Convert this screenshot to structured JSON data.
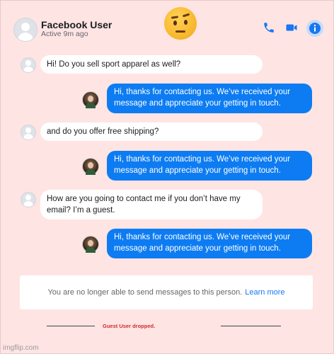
{
  "header": {
    "name": "Facebook User",
    "status": "Active 9m ago",
    "icons": [
      "phone-icon",
      "video-camera-icon",
      "info-icon"
    ]
  },
  "messages": [
    {
      "from": "user",
      "text": "Hi! Do you sell sport apparel as well?"
    },
    {
      "from": "business",
      "text": "Hi, thanks for contacting us. We’ve received your message and appreciate your getting in touch."
    },
    {
      "from": "user",
      "text": "and do you offer free shipping?"
    },
    {
      "from": "business",
      "text": "Hi, thanks for contacting us. We’ve received your message and appreciate your getting in touch."
    },
    {
      "from": "user",
      "text": "How are you going to contact me if you don’t have my email? I’m a guest."
    },
    {
      "from": "business",
      "text": "Hi, thanks for contacting us. We’ve received your message and appreciate your getting in touch."
    }
  ],
  "notice": {
    "text": "You are no longer able to send messages to this person.",
    "link": "Learn more"
  },
  "dropped": "Guest User dropped.",
  "watermark": "imgflip.com",
  "colors": {
    "background": "#ffe4e4",
    "outgoing_bubble": "#0d7cf2",
    "accent": "#1877f2",
    "dropped_text": "#d12b2b"
  }
}
